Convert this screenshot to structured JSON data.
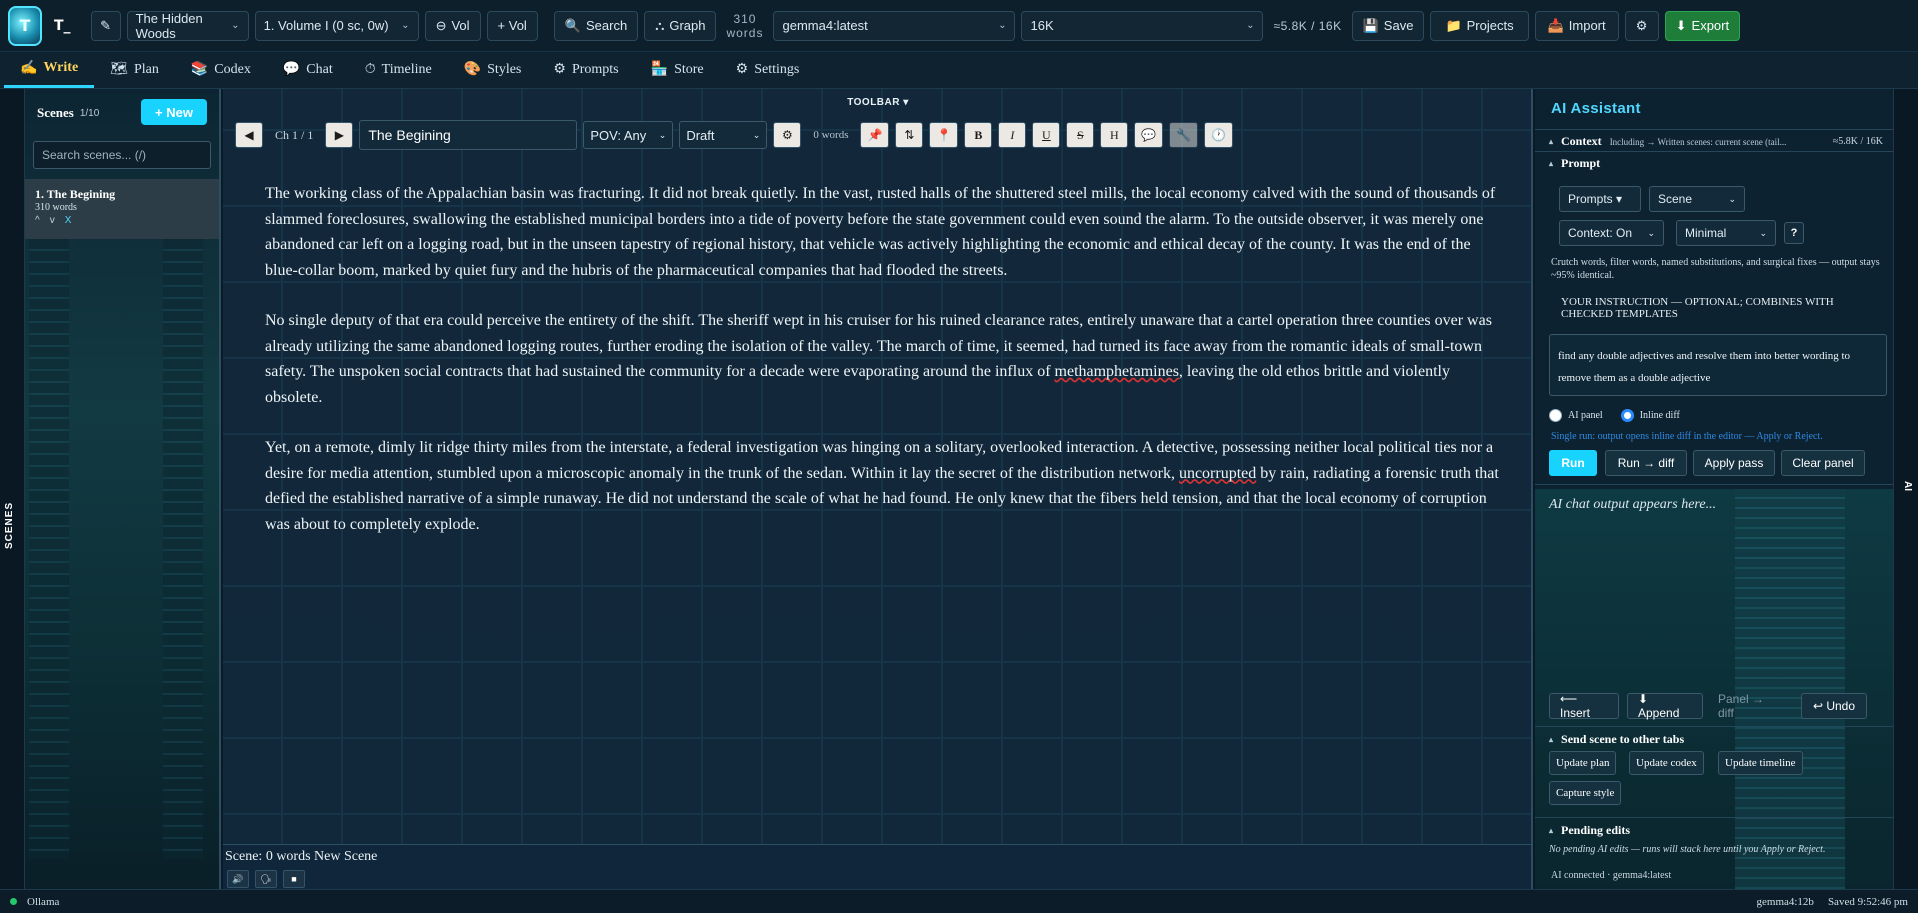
{
  "app": {
    "brand": "T_",
    "logo_char": "T"
  },
  "topbar": {
    "project": "The Hidden Woods",
    "volume": "1. Volume I (0 sc, 0w)",
    "vol_remove": "Vol",
    "vol_add": "+ Vol",
    "search": "Search",
    "graph": "Graph",
    "word_count": "310",
    "word_label": "words",
    "model": "gemma4:latest",
    "context_size": "16K",
    "token_usage": "≈5.8K / 16K",
    "save": "Save",
    "projects": "Projects",
    "import": "Import",
    "export": "Export"
  },
  "nav": {
    "tabs": [
      {
        "icon": "✍",
        "label": "Write"
      },
      {
        "icon": "🗺",
        "label": "Plan"
      },
      {
        "icon": "📚",
        "label": "Codex"
      },
      {
        "icon": "💬",
        "label": "Chat"
      },
      {
        "icon": "⏱",
        "label": "Timeline"
      },
      {
        "icon": "🎨",
        "label": "Styles"
      },
      {
        "icon": "⚙",
        "label": "Prompts"
      },
      {
        "icon": "🏪",
        "label": "Store"
      },
      {
        "icon": "⚙",
        "label": "Settings"
      }
    ]
  },
  "scenes": {
    "side_label": "SCENES",
    "title": "Scenes",
    "count": "1/10",
    "new_button": "+ New",
    "search_placeholder": "Search scenes... (/)",
    "items": [
      {
        "title": "1. The Begining",
        "words": "310 words",
        "up": "^",
        "down": "v",
        "remove": "X"
      }
    ]
  },
  "editor": {
    "toolbar_label": "TOOLBAR ▾",
    "chapter": "Ch 1 / 1",
    "scene_title": "The Begining",
    "pov": "POV: Any",
    "status": "Draft",
    "scene_words": "0 words",
    "format_buttons": {
      "bold": "B",
      "italic": "I",
      "underline": "U",
      "strike": "S",
      "heading": "H"
    },
    "paragraphs": [
      "The working class of the Appalachian basin was fracturing. It did not break quietly. In the vast, rusted halls of the shuttered steel mills, the local economy calved with the sound of thousands of slammed foreclosures, swallowing the established municipal borders into a tide of poverty before the state government could even sound the alarm. To the outside observer, it was merely one abandoned car left on a logging road, but in the unseen tapestry of regional history, that vehicle was actively highlighting the economic and ethical decay of the county. It was the end of the blue-collar boom, marked by quiet fury and the hubris of the pharmaceutical companies that had flooded the streets.",
      "No single deputy of that era could perceive the entirety of the shift. The sheriff wept in his cruiser for his ruined clearance rates, entirely unaware that a cartel operation three counties over was already utilizing the same abandoned logging routes, further eroding the isolation of the valley. The march of time, it seemed, had turned its face away from the romantic ideals of small-town safety. The unspoken social contracts that had sustained the community for a decade were evaporating around the influx of methamphetamines, leaving the old ethos brittle and violently obsolete.",
      "Yet, on a remote, dimly lit ridge thirty miles from the interstate, a federal investigation was hinging on a solitary, overlooked interaction. A detective, possessing neither local political ties nor a desire for media attention, stumbled upon a microscopic anomaly in the trunk of the sedan. Within it lay the secret of the distribution network, uncorrupted by rain, radiating a forensic truth that defied the established narrative of a simple runaway. He did not understand the scale of what he had found. He only knew that the fibers held tension, and that the local economy of corruption was about to completely explode."
    ],
    "p2_before": "No single deputy of that era could perceive the entirety of the shift. The sheriff wept in his cruiser for his ruined clearance rates, entirely unaware that a cartel operation three counties over was already utilizing the same abandoned logging routes, further eroding the isolation of the valley. The march of time, it seemed, had turned its face away from the romantic ideals of small-town safety. The unspoken social contracts that had sustained the community for a decade were evaporating around the influx of ",
    "p2_flag": "methamphetamines",
    "p2_after": ", leaving the old ethos brittle and violently obsolete.",
    "p3_before": "Yet, on a remote, dimly lit ridge thirty miles from the interstate, a federal investigation was hinging on a solitary, overlooked interaction. A detective, possessing neither local political ties nor a desire for media attention, stumbled upon a microscopic anomaly in the trunk of the sedan. Within it lay the secret of the distribution network, ",
    "p3_flag": "uncorrupted",
    "p3_after": " by rain, radiating a forensic truth that defied the established narrative of a simple runaway. He did not understand the scale of what he had found. He only knew that the fibers held tension, and that the local economy of corruption was about to completely explode.",
    "footer_status": "Scene: 0 words New Scene"
  },
  "ai": {
    "side_label": "AI",
    "title": "AI Assistant",
    "context_title": "Context",
    "context_note": "Including → Written scenes: current scene (tail...",
    "context_tokens": "≈5.8K / 16K",
    "prompt_title": "Prompt",
    "prompts_select": "Prompts ▾",
    "scope_select": "Scene",
    "context_select": "Context: On",
    "detail_select": "Minimal",
    "help": "?",
    "description": "Crutch words, filter words, named substitutions, and surgical fixes — output stays ~95% identical.",
    "instruction_label": "Your instruction — optional; combines with checked templates",
    "instruction_text": "find any double adjectives and resolve them into better wording to remove them as a double adjective",
    "radio_panel": "AI panel",
    "radio_inline": "Inline diff",
    "single_run_note": "Single run: output opens inline diff in the editor — Apply or Reject.",
    "run": "Run",
    "run_diff": "Run → diff",
    "apply_pass": "Apply pass",
    "clear_panel": "Clear panel",
    "chat_placeholder": "AI chat output appears here...",
    "insert": "⟵ Insert",
    "append": "⬇ Append",
    "panel_diff": "Panel → diff",
    "undo": "↩ Undo",
    "send_title": "Send scene to other tabs",
    "update_plan": "Update plan",
    "update_codex": "Update codex",
    "update_timeline": "Update timeline",
    "capture_style": "Capture style",
    "pending_title": "Pending edits",
    "pending_note": "No pending AI edits — runs will stack here until you Apply or Reject.",
    "status": "AI connected · gemma4:latest"
  },
  "statusbar": {
    "provider": "Ollama",
    "model": "gemma4:12b",
    "saved": "Saved 9:52:46 pm"
  }
}
